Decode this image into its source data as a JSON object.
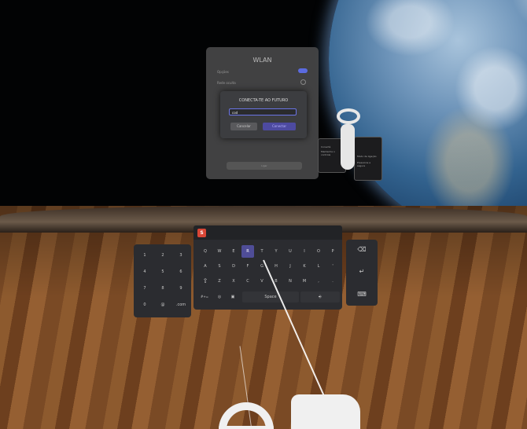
{
  "wlan": {
    "title": "WLAN",
    "rows": [
      "Opções",
      "Rede oculta"
    ],
    "bottom_button": "Ligar"
  },
  "dialog": {
    "title": "CONECTA-TE AO FUTURO",
    "input_value": "cod",
    "cancel_label": "Cancelar",
    "connect_label": "Conectar"
  },
  "controller_cards": {
    "left_title": "Conectá",
    "left_sub": "Mantenha o controle",
    "right_title": "Modo de ligação",
    "right_sub": "Pressione e segure"
  },
  "keyboard": {
    "logo": "S",
    "rows": [
      [
        "Q",
        "W",
        "E",
        "R",
        "T",
        "Y",
        "U",
        "I",
        "O",
        "P"
      ],
      [
        "A",
        "S",
        "D",
        "F",
        "G",
        "H",
        "J",
        "K",
        "L",
        "'"
      ],
      [
        "Z",
        "X",
        "C",
        "V",
        "B",
        "N",
        "M",
        ",",
        "."
      ]
    ],
    "active_key": "R",
    "bottom": {
      "symbols": "#+=",
      "globe": "◎",
      "emoji": "▣",
      "space": "Space",
      "mic": "⎆"
    },
    "shift": "⇧",
    "numpad": [
      [
        "1",
        "2",
        "3"
      ],
      [
        "4",
        "5",
        "6"
      ],
      [
        "7",
        "8",
        "9"
      ],
      [
        "0",
        "@",
        ".com"
      ]
    ],
    "right": [
      "⌫",
      "↵",
      "⌨"
    ]
  },
  "colors": {
    "accent": "#4f4d97",
    "dialog_border": "#6a74e6",
    "logo": "#d94636"
  }
}
